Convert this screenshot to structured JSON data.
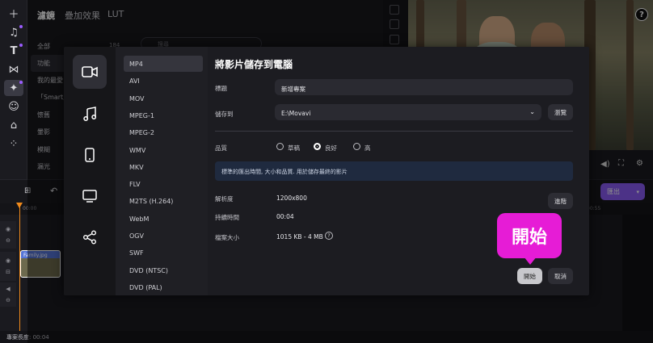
{
  "filters_panel": {
    "tabs": [
      "濾鏡",
      "疊加效果",
      "LUT"
    ],
    "categories": [
      {
        "label": "全部",
        "count": "184"
      },
      {
        "label": "功能"
      },
      {
        "label": "我的最愛"
      },
      {
        "label": "「Smart」"
      },
      {
        "label": "懷舊"
      },
      {
        "label": "暈影"
      },
      {
        "label": "模糊"
      },
      {
        "label": "漏光"
      }
    ],
    "search_placeholder": "搜尋"
  },
  "timeline": {
    "ruler_start": "00:00",
    "ruler_end": "00:55",
    "clip_label": "Family.jpg",
    "export_button": "匯出"
  },
  "status_bar": {
    "project_length": "專案長度: 00:04"
  },
  "export_dialog": {
    "title": "將影片儲存到電腦",
    "formats": [
      "MP4",
      "AVI",
      "MOV",
      "MPEG-1",
      "MPEG-2",
      "WMV",
      "MKV",
      "FLV",
      "M2TS (H.264)",
      "WebM",
      "OGV",
      "SWF",
      "DVD (NTSC)",
      "DVD (PAL)"
    ],
    "selected_format": "MP4",
    "title_label": "標題",
    "title_value": "新增專案",
    "save_to_label": "儲存到",
    "save_to_value": "E:\\Movavi",
    "browse_button": "瀏覽",
    "quality_label": "品質",
    "quality_options": [
      "草稿",
      "良好",
      "高"
    ],
    "quality_selected": "良好",
    "quality_info": "標準的匯出時間, 大小和品質. 用於儲存最終的影片",
    "resolution_label": "解析度",
    "resolution_value": "1200x800",
    "advanced_button": "進階",
    "duration_label": "持續時間",
    "duration_value": "00:04",
    "filesize_label": "檔案大小",
    "filesize_value": "1015 KB - 4 MB",
    "start_button": "開始",
    "cancel_button": "取消"
  },
  "callout": {
    "text": "開始"
  },
  "colors": {
    "accent": "#8b5cf6",
    "callout": "#e61cd6",
    "info_bg": "#1f2a3f"
  }
}
